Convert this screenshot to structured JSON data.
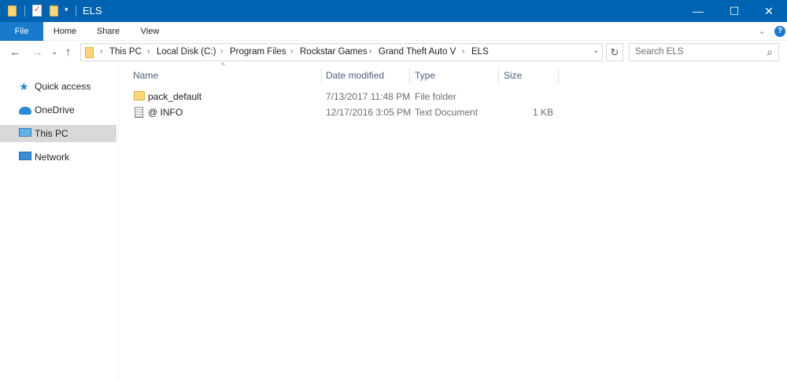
{
  "window": {
    "title": "ELS",
    "minimize": "—",
    "maximize": "☐",
    "close": "✕"
  },
  "ribbon": {
    "tabs": [
      "File",
      "Home",
      "Share",
      "View"
    ],
    "help": "?",
    "expand": "⌄"
  },
  "nav": {
    "back": "←",
    "forward": "→",
    "recent": "⌄",
    "up": "↑"
  },
  "address": {
    "crumbs": [
      "This PC",
      "Local Disk (C:)",
      "Program Files",
      "Rockstar Games",
      "Grand Theft Auto V",
      "ELS"
    ],
    "dropdown": "⌄",
    "refresh": "↻"
  },
  "search": {
    "placeholder": "Search ELS",
    "icon": "⌕"
  },
  "sidebar": {
    "items": [
      {
        "label": "Quick access",
        "icon": "star-icon"
      },
      {
        "label": "OneDrive",
        "icon": "cloud-icon"
      },
      {
        "label": "This PC",
        "icon": "computer-icon",
        "selected": true
      },
      {
        "label": "Network",
        "icon": "network-icon"
      }
    ]
  },
  "columns": {
    "name": "Name",
    "date": "Date modified",
    "type": "Type",
    "size": "Size",
    "sort_indicator": "^"
  },
  "files": [
    {
      "name": "pack_default",
      "date": "7/13/2017 11:48 PM",
      "type": "File folder",
      "size": "",
      "icon": "folder-icon"
    },
    {
      "name": "@ INFO",
      "date": "12/17/2016 3:05 PM",
      "type": "Text Document",
      "size": "1 KB",
      "icon": "text-file-icon"
    }
  ]
}
